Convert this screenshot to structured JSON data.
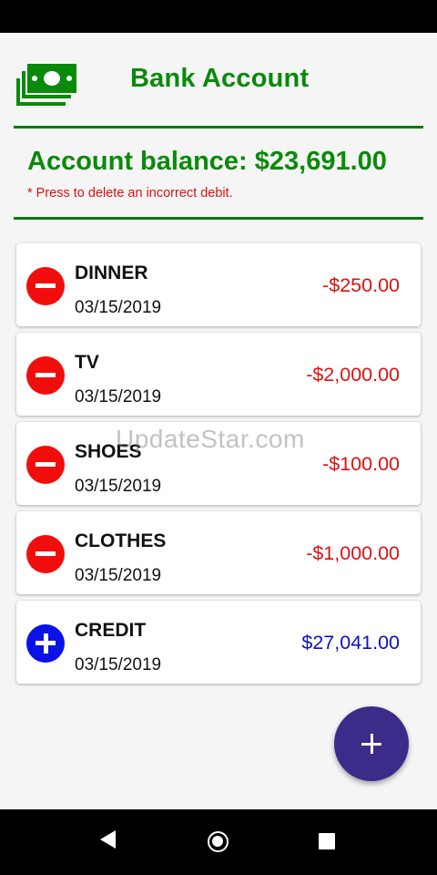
{
  "app": {
    "title": "Bank Account",
    "logo_icon": "money-bills-icon",
    "brand_color": "#0a8a0a"
  },
  "balance": {
    "text": "Account balance: $23,691.00",
    "hint": "* Press to delete an incorrect debit."
  },
  "transactions": [
    {
      "name": "DINNER",
      "date": "03/15/2019",
      "amount": "-$250.00",
      "type": "debit"
    },
    {
      "name": "TV",
      "date": "03/15/2019",
      "amount": "-$2,000.00",
      "type": "debit"
    },
    {
      "name": "SHOES",
      "date": "03/15/2019",
      "amount": "-$100.00",
      "type": "debit"
    },
    {
      "name": "CLOTHES",
      "date": "03/15/2019",
      "amount": "-$1,000.00",
      "type": "debit"
    },
    {
      "name": "CREDIT",
      "date": "03/15/2019",
      "amount": "$27,041.00",
      "type": "credit"
    }
  ],
  "colors": {
    "debit": "#e01010",
    "credit": "#1010c0",
    "fab": "#3d2b8a"
  },
  "watermark": "UpdateStar.com",
  "fab": {
    "icon": "plus-icon"
  },
  "nav": {
    "back_icon": "back-triangle-icon",
    "home_icon": "home-circle-icon",
    "recent_icon": "recents-square-icon"
  }
}
